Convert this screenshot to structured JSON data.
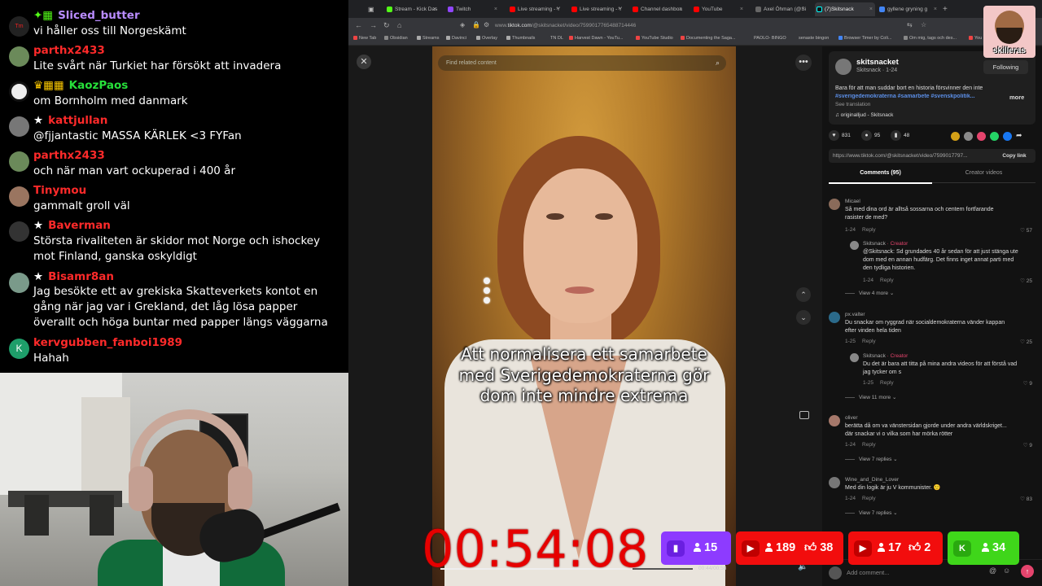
{
  "chat": {
    "messages": [
      {
        "user": "Sliced_butter",
        "badge": "✦▦",
        "text": "vi håller oss till Norgeskämt",
        "color": "#b98cff"
      },
      {
        "user": "parthx2433",
        "badge": "",
        "text": "Lite svårt när Turkiet har försökt att invadera",
        "color": "#ff2a2a"
      },
      {
        "user": "KaozPaos",
        "badge": "♛▦▦",
        "text": "om Bornholm med danmark",
        "color": "#27e03a"
      },
      {
        "user": "kattjullan",
        "badge": "★",
        "text": "@fjjantastic MASSA KÄRLEK <3 FYFan",
        "color": "#ff2a2a"
      },
      {
        "user": "parthx2433",
        "badge": "",
        "text": "och när man vart ockuperad i 400 år",
        "color": "#ff2a2a"
      },
      {
        "user": "Tinymou",
        "badge": "",
        "text": "gammalt groll väl",
        "color": "#ff2a2a"
      },
      {
        "user": "Baverman",
        "badge": "★",
        "text": "Största rivaliteten är skidor mot Norge och ishockey mot Finland, ganska oskyldigt",
        "color": "#ff2a2a"
      },
      {
        "user": "Bisamr8an",
        "badge": "★",
        "text": "Jag besökte ett av grekiska Skatteverkets kontot en gång när jag var i Grekland, det låg lösa papper överallt och höga buntar med papper längs väggarna",
        "color": "#ff2a2a"
      },
      {
        "user": "kervgubben_fanboi1989",
        "badge": "",
        "text": "Hahah",
        "color": "#ff2a2a"
      }
    ]
  },
  "browser": {
    "tabs": [
      {
        "label": "Stream - Kick Das",
        "color": "#53fc18"
      },
      {
        "label": "Twitch",
        "color": "#9146ff"
      },
      {
        "label": "Live streaming - Y",
        "color": "#ff0000"
      },
      {
        "label": "Live streaming - Y",
        "color": "#ff0000"
      },
      {
        "label": "Channel dashboa",
        "color": "#ff0000"
      },
      {
        "label": "YouTube",
        "color": "#ff0000"
      },
      {
        "label": "Axel Öhman (@Si",
        "color": "#444"
      },
      {
        "label": "(7)Skitsnack",
        "color": "#111"
      },
      {
        "label": "gyllene gryning g",
        "color": "#4285f4"
      }
    ],
    "url_prefix": "www.",
    "url_domain": "tiktok.com",
    "url_path": "/@skitsnacket/video/7599017765488714446",
    "bookmarks": [
      "New Tab",
      "Obsidian",
      "Streams",
      "Davinci",
      "Overlay",
      "Thumbnails",
      "TN DL",
      "Harvest Dawn - YouTu...",
      "YouTube Studio",
      "Documenting the Saga...",
      "PAOLO- BINGO",
      "senaste bingon",
      "Browser Timer by Coli...",
      "Om mig, tags och des...",
      "You"
    ]
  },
  "tiktok": {
    "search_placeholder": "Find related content",
    "caption": "Att normalisera ett samarbete med Sverigedemokraterna gör dom inte mindre extrema",
    "video_time": "00:44/00:58",
    "video_progress": 0.76,
    "author": {
      "name": "skitsnacket",
      "sub": "Skitsnack · 1-24",
      "follow_label": "Following"
    },
    "description": "Bara för att man suddar bort en historia försvinner den inte",
    "tags": "#sverigedemokraterna #samarbete #svenskpolitik...",
    "more_label": "more",
    "see_translation": "See translation",
    "sound": "♫  originalljud - Skitsnack",
    "likes": "831",
    "comments_count": "95",
    "saves": "48",
    "share_link": "https://www.tiktok.com/@skitsnacket/video/7599017797...",
    "copy_label": "Copy link",
    "tab_comments": "Comments (95)",
    "tab_creator": "Creator videos",
    "comments": [
      {
        "user": "Micael",
        "creator": "",
        "text": "Så med dina ord är alltså sossarna och centern fortfarande rasister de med?",
        "date": "1-24",
        "reply": "Reply",
        "likes": "57",
        "indent": false,
        "replies_label": ""
      },
      {
        "user": "Skitsnack",
        "creator": " · Creator",
        "text": "@Skitsnack: Sd grundades 40 år sedan för att just stänga ute dom med en annan hudfärg. Det finns inget annat parti med den tydliga historien.",
        "date": "1-24",
        "reply": "Reply",
        "likes": "25",
        "indent": true,
        "replies_label": "View 4 more"
      },
      {
        "user": "px.valter",
        "creator": "",
        "text": "Du snackar om ryggrad när socialdemokraterna vänder kappan efter vinden hela tiden",
        "date": "1-25",
        "reply": "Reply",
        "likes": "25",
        "indent": false,
        "replies_label": ""
      },
      {
        "user": "Skitsnack",
        "creator": " · Creator",
        "text": "Du det är bara att titta på mina andra videos för att förstå vad jag tycker om s",
        "date": "1-25",
        "reply": "Reply",
        "likes": "9",
        "indent": true,
        "replies_label": "View 11 more"
      },
      {
        "user": "oliver",
        "creator": "",
        "text": "berätta då om va vänstersidan gjorde under andra världskriget... där snackar vi o vilka som har mörka rötter",
        "date": "1-24",
        "reply": "Reply",
        "likes": "9",
        "indent": false,
        "replies_label": "View 7 replies"
      },
      {
        "user": "Wine_and_Dine_Lover",
        "creator": "",
        "text": "Med din logik är ju V kommunister. 🙂",
        "date": "1-24",
        "reply": "Reply",
        "likes": "83",
        "indent": false,
        "replies_label": "View 7 replies"
      }
    ],
    "add_comment_placeholder": "Add comment..."
  },
  "overlay": {
    "timer": "00:54:08",
    "logo_text": "skilleras",
    "viewers": [
      {
        "platform": "twitch",
        "viewers": "15",
        "likes": "",
        "bg": "#8d3bff",
        "icon_bg": "#6a1fe0"
      },
      {
        "platform": "youtube",
        "viewers": "189",
        "likes": "38",
        "bg": "#f20d0d",
        "icon_bg": "#c00000"
      },
      {
        "platform": "youtube",
        "viewers": "17",
        "likes": "2",
        "bg": "#f20d0d",
        "icon_bg": "#c00000"
      },
      {
        "platform": "kick",
        "viewers": "34",
        "likes": "",
        "bg": "#3fd61a",
        "icon_bg": "#2aa90f"
      }
    ]
  }
}
